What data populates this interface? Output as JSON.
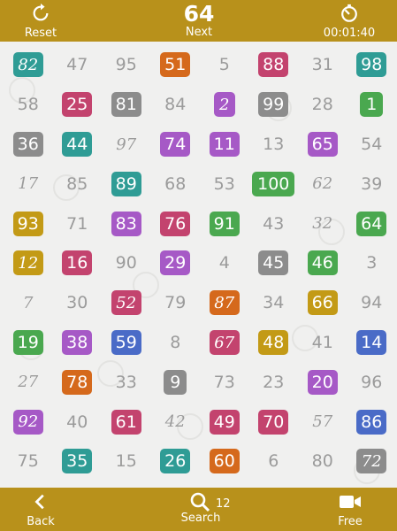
{
  "top": {
    "reset_label": "Reset",
    "reset_icon": "refresh-icon",
    "next_number": "64",
    "next_label": "Next",
    "timer": "00:01:40",
    "timer_icon": "stopwatch-icon"
  },
  "bottom": {
    "back_label": "Back",
    "back_icon": "chevron-left-icon",
    "search_label": "Search",
    "search_count": "12",
    "search_icon": "magnifier-icon",
    "free_label": "Free",
    "free_icon": "video-camera-icon"
  },
  "colors": {
    "bar": "#b8911b",
    "green": "#4aa84f",
    "orange": "#d5691c",
    "pink": "#c3436e",
    "purple": "#a659c6",
    "teal": "#2f9c95",
    "gray": "#8c8c8c",
    "blue": "#4a6bc7",
    "mustard": "#c39a16",
    "olive": "#8aa21c",
    "plain_text": "#9b9b9b"
  },
  "rows": [
    [
      {
        "n": "82",
        "c": "teal",
        "h": true
      },
      {
        "n": "47"
      },
      {
        "n": "95"
      },
      {
        "n": "51",
        "c": "orange"
      },
      {
        "n": "5"
      },
      {
        "n": "88",
        "c": "pink"
      },
      {
        "n": "31"
      },
      {
        "n": "98",
        "c": "teal"
      }
    ],
    [
      {
        "n": "58"
      },
      {
        "n": "25",
        "c": "pink"
      },
      {
        "n": "81",
        "c": "gray"
      },
      {
        "n": "84"
      },
      {
        "n": "2",
        "c": "purple",
        "h": true
      },
      {
        "n": "99",
        "c": "gray"
      },
      {
        "n": "28"
      },
      {
        "n": "1",
        "c": "green"
      }
    ],
    [
      {
        "n": "36",
        "c": "gray"
      },
      {
        "n": "44",
        "c": "teal"
      },
      {
        "n": "97",
        "h": true
      },
      {
        "n": "74",
        "c": "purple"
      },
      {
        "n": "11",
        "c": "purple"
      },
      {
        "n": "13"
      },
      {
        "n": "65",
        "c": "purple"
      },
      {
        "n": "54"
      }
    ],
    [
      {
        "n": "17",
        "h": true
      },
      {
        "n": "85"
      },
      {
        "n": "89",
        "c": "teal"
      },
      {
        "n": "68"
      },
      {
        "n": "53"
      },
      {
        "n": "100",
        "c": "green"
      },
      {
        "n": "62",
        "h": true
      },
      {
        "n": "39"
      }
    ],
    [
      {
        "n": "93",
        "c": "mustard"
      },
      {
        "n": "71"
      },
      {
        "n": "83",
        "c": "purple"
      },
      {
        "n": "76",
        "c": "pink"
      },
      {
        "n": "91",
        "c": "green"
      },
      {
        "n": "43"
      },
      {
        "n": "32",
        "h": true
      },
      {
        "n": "64",
        "c": "green"
      }
    ],
    [
      {
        "n": "12",
        "c": "mustard",
        "h": true
      },
      {
        "n": "16",
        "c": "pink"
      },
      {
        "n": "90"
      },
      {
        "n": "29",
        "c": "purple"
      },
      {
        "n": "4"
      },
      {
        "n": "45",
        "c": "gray"
      },
      {
        "n": "46",
        "c": "green"
      },
      {
        "n": "3"
      }
    ],
    [
      {
        "n": "7",
        "h": true
      },
      {
        "n": "30"
      },
      {
        "n": "52",
        "c": "pink",
        "h": true
      },
      {
        "n": "79"
      },
      {
        "n": "87",
        "c": "orange",
        "h": true
      },
      {
        "n": "34"
      },
      {
        "n": "66",
        "c": "mustard"
      },
      {
        "n": "94"
      }
    ],
    [
      {
        "n": "19",
        "c": "green"
      },
      {
        "n": "38",
        "c": "purple"
      },
      {
        "n": "59",
        "c": "blue"
      },
      {
        "n": "8"
      },
      {
        "n": "67",
        "c": "pink",
        "h": true
      },
      {
        "n": "48",
        "c": "mustard"
      },
      {
        "n": "41"
      },
      {
        "n": "14",
        "c": "blue"
      }
    ],
    [
      {
        "n": "27",
        "h": true
      },
      {
        "n": "78",
        "c": "orange"
      },
      {
        "n": "33"
      },
      {
        "n": "9",
        "c": "gray"
      },
      {
        "n": "73"
      },
      {
        "n": "23"
      },
      {
        "n": "20",
        "c": "purple"
      },
      {
        "n": "96"
      }
    ],
    [
      {
        "n": "92",
        "c": "purple",
        "h": true
      },
      {
        "n": "40"
      },
      {
        "n": "61",
        "c": "pink"
      },
      {
        "n": "42",
        "h": true
      },
      {
        "n": "49",
        "c": "pink"
      },
      {
        "n": "70",
        "c": "pink"
      },
      {
        "n": "57",
        "h": true
      },
      {
        "n": "86",
        "c": "blue"
      }
    ],
    [
      {
        "n": "75"
      },
      {
        "n": "35",
        "c": "teal"
      },
      {
        "n": "15"
      },
      {
        "n": "26",
        "c": "teal"
      },
      {
        "n": "60",
        "c": "orange"
      },
      {
        "n": "6"
      },
      {
        "n": "80"
      },
      {
        "n": "72",
        "c": "gray",
        "h": true
      }
    ]
  ]
}
